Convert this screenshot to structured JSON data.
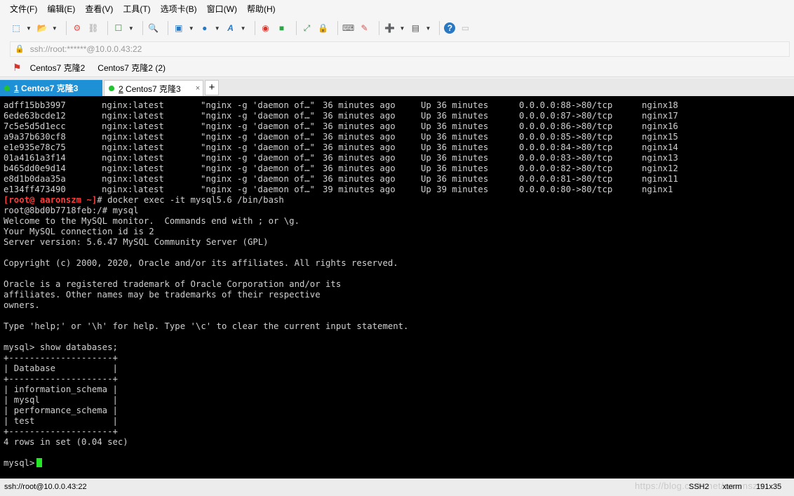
{
  "menu": [
    "文件(F)",
    "编辑(E)",
    "查看(V)",
    "工具(T)",
    "选项卡(B)",
    "窗口(W)",
    "帮助(H)"
  ],
  "address": {
    "text": "ssh://root:******@10.0.0.43:22"
  },
  "links": [
    "Centos7 克隆2",
    "Centos7 克隆2 (2)"
  ],
  "tabs": [
    {
      "num": "1",
      "title": " Centos7 克隆3"
    },
    {
      "num": "2",
      "title": " Centos7 克隆3"
    }
  ],
  "tab_add": "+",
  "tab_close": "×",
  "containers": [
    {
      "id": "adff15bb3997",
      "image": "nginx:latest",
      "command": "\"nginx -g 'daemon of…\"",
      "created": "36 minutes ago",
      "status": "Up 36 minutes",
      "ports": "0.0.0.0:88->80/tcp",
      "name": "nginx18"
    },
    {
      "id": "6ede63bcde12",
      "image": "nginx:latest",
      "command": "\"nginx -g 'daemon of…\"",
      "created": "36 minutes ago",
      "status": "Up 36 minutes",
      "ports": "0.0.0.0:87->80/tcp",
      "name": "nginx17"
    },
    {
      "id": "7c5e5d5d1ecc",
      "image": "nginx:latest",
      "command": "\"nginx -g 'daemon of…\"",
      "created": "36 minutes ago",
      "status": "Up 36 minutes",
      "ports": "0.0.0.0:86->80/tcp",
      "name": "nginx16"
    },
    {
      "id": "a9a37b630cf8",
      "image": "nginx:latest",
      "command": "\"nginx -g 'daemon of…\"",
      "created": "36 minutes ago",
      "status": "Up 36 minutes",
      "ports": "0.0.0.0:85->80/tcp",
      "name": "nginx15"
    },
    {
      "id": "e1e935e78c75",
      "image": "nginx:latest",
      "command": "\"nginx -g 'daemon of…\"",
      "created": "36 minutes ago",
      "status": "Up 36 minutes",
      "ports": "0.0.0.0:84->80/tcp",
      "name": "nginx14"
    },
    {
      "id": "01a4161a3f14",
      "image": "nginx:latest",
      "command": "\"nginx -g 'daemon of…\"",
      "created": "36 minutes ago",
      "status": "Up 36 minutes",
      "ports": "0.0.0.0:83->80/tcp",
      "name": "nginx13"
    },
    {
      "id": "b465dd0e9d14",
      "image": "nginx:latest",
      "command": "\"nginx -g 'daemon of…\"",
      "created": "36 minutes ago",
      "status": "Up 36 minutes",
      "ports": "0.0.0.0:82->80/tcp",
      "name": "nginx12"
    },
    {
      "id": "e8d1b0daa35a",
      "image": "nginx:latest",
      "command": "\"nginx -g 'daemon of…\"",
      "created": "36 minutes ago",
      "status": "Up 36 minutes",
      "ports": "0.0.0.0:81->80/tcp",
      "name": "nginx11"
    },
    {
      "id": "e134ff473490",
      "image": "nginx:latest",
      "command": "\"nginx -g 'daemon of…\"",
      "created": "39 minutes ago",
      "status": "Up 39 minutes",
      "ports": "0.0.0.0:80->80/tcp",
      "name": "nginx1"
    }
  ],
  "prompt": {
    "user": "[root@ aaronszm ~]",
    "cmd": "# docker exec -it mysql5.6 /bin/bash"
  },
  "output": [
    "root@8bd0b7718feb:/# mysql",
    "Welcome to the MySQL monitor.  Commands end with ; or \\g.",
    "Your MySQL connection id is 2",
    "Server version: 5.6.47 MySQL Community Server (GPL)",
    "",
    "Copyright (c) 2000, 2020, Oracle and/or its affiliates. All rights reserved.",
    "",
    "Oracle is a registered trademark of Oracle Corporation and/or its",
    "affiliates. Other names may be trademarks of their respective",
    "owners.",
    "",
    "Type 'help;' or '\\h' for help. Type '\\c' to clear the current input statement.",
    "",
    "mysql> show databases;",
    "+--------------------+",
    "| Database           |",
    "+--------------------+",
    "| information_schema |",
    "| mysql              |",
    "| performance_schema |",
    "| test               |",
    "+--------------------+",
    "4 rows in set (0.04 sec)",
    ""
  ],
  "final_prompt": "mysql>",
  "status": {
    "connection": "ssh://root@10.0.0.43:22",
    "protocol": "SSH2",
    "terminal": "xterm",
    "size": "191x35",
    "watermark": "https://blog.csdn.net/aaronszm"
  },
  "colors": {
    "accent": "#1e90d6",
    "prompt": "#ff3c3c",
    "cursor": "#23e823",
    "terminal_bg": "#000000",
    "terminal_fg": "#d0d0d0"
  }
}
